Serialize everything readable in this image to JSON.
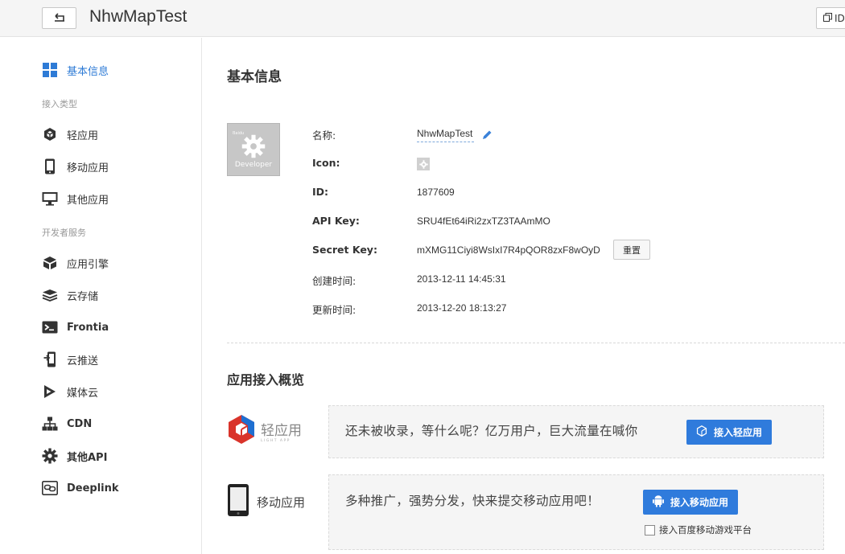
{
  "header": {
    "back_icon": "return-arrow-icon",
    "title": "NhwMapTest",
    "right_button_label": "ID",
    "right_button_icon": "copy-icon"
  },
  "sidebar": {
    "items": [
      {
        "label": "基本信息",
        "icon": "grid-icon",
        "active": true
      },
      {
        "label": "轻应用",
        "icon": "light-app-icon"
      },
      {
        "label": "移动应用",
        "icon": "mobile-icon"
      },
      {
        "label": "其他应用",
        "icon": "monitor-icon"
      },
      {
        "label": "应用引擎",
        "icon": "engine-icon"
      },
      {
        "label": "云存储",
        "icon": "storage-icon"
      },
      {
        "label": "Frontia",
        "icon": "terminal-icon"
      },
      {
        "label": "云推送",
        "icon": "push-icon"
      },
      {
        "label": "媒体云",
        "icon": "media-icon"
      },
      {
        "label": "CDN",
        "icon": "network-icon"
      },
      {
        "label": "其他API",
        "icon": "gear-icon"
      },
      {
        "label": "Deeplink",
        "icon": "link-icon"
      }
    ],
    "groups": {
      "access_types": "接入类型",
      "dev_services": "开发者服务"
    }
  },
  "main": {
    "basic_info": {
      "title": "基本信息",
      "icon_caption_small": "Baidu",
      "icon_caption": "Developer",
      "fields": {
        "name_label": "名称:",
        "name_value": "NhwMapTest",
        "icon_label": "Icon:",
        "id_label": "ID:",
        "id_value": "1877609",
        "apikey_label": "API Key:",
        "apikey_value": "SRU4fEt64iRi2zxTZ3TAAmMO",
        "secret_label": "Secret Key:",
        "secret_value": "mXMG11Ciyi8WsIxI7R4pQOR8zxF8wOyD",
        "reset_label": "重置",
        "created_label": "创建时间:",
        "created_value": "2013-12-11 14:45:31",
        "updated_label": "更新时间:",
        "updated_value": "2013-12-20 18:13:27"
      }
    },
    "overview": {
      "title": "应用接入概览",
      "light_app": {
        "logo_text": "轻应用",
        "logo_sub": "LIGHT APP",
        "text": "还未被收录，等什么呢？亿万用户，巨大流量在喊你",
        "button": "接入轻应用"
      },
      "mobile_app": {
        "logo_text": "移动应用",
        "text": "多种推广，强势分发，快来提交移动应用吧！",
        "button": "接入移动应用",
        "checkbox_label": "接入百度移动游戏平台",
        "checkbox_checked": false
      }
    }
  },
  "colors": {
    "accent": "#2e7bd6",
    "button_blue": "#2f7bdc"
  }
}
